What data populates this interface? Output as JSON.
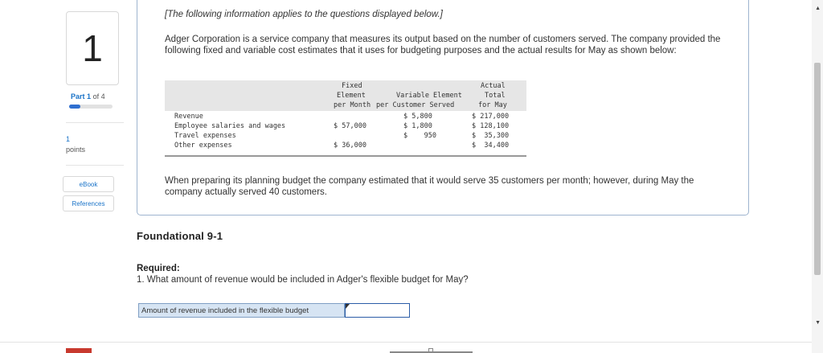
{
  "question": {
    "number": "1",
    "part_label": "Part",
    "part_num": "1",
    "part_of": "of 4",
    "part_progress_fraction": 0.25,
    "points_value": "1",
    "points_label": "points"
  },
  "sidebar": {
    "ebook_label": "eBook",
    "references_label": "References"
  },
  "info": {
    "intro": "[The following information applies to the questions displayed below.]",
    "description": "Adger Corporation is a service company that measures its output based on the number of customers served. The company provided the following fixed and variable cost estimates that it uses for budgeting purposes and the actual results for May as shown below:",
    "table": {
      "headers": {
        "fixed_1": "Fixed",
        "fixed_2": "Element",
        "fixed_3": "per Month",
        "variable_2": "Variable Element",
        "variable_3": "per Customer Served",
        "actual_1": "Actual",
        "actual_2": "Total",
        "actual_3": "for May"
      },
      "rows": [
        {
          "label": "Revenue",
          "fixed": "",
          "variable": "$ 5,800",
          "actual": "$ 217,000"
        },
        {
          "label": "Employee salaries and wages",
          "fixed": "$ 57,000",
          "variable": "$ 1,800",
          "actual": "$ 128,100"
        },
        {
          "label": "Travel expenses",
          "fixed": "",
          "variable": "$    950",
          "actual": "$  35,300"
        },
        {
          "label": "Other expenses",
          "fixed": "$ 36,000",
          "variable": "",
          "actual": "$  34,400"
        }
      ]
    },
    "planning_note": "When preparing its planning budget the company estimated that it would serve 35 customers per month; however, during May the company actually served 40 customers."
  },
  "main": {
    "title": "Foundational 9-1",
    "required_label": "Required:",
    "question_text": "1. What amount of revenue would be included in Adger's flexible budget for May?",
    "answer_label": "Amount of revenue included in the flexible budget",
    "answer_value": ""
  },
  "icons": {
    "scroll_up": "scroll-up-arrow-icon",
    "scroll_down": "scroll-down-arrow-icon"
  }
}
